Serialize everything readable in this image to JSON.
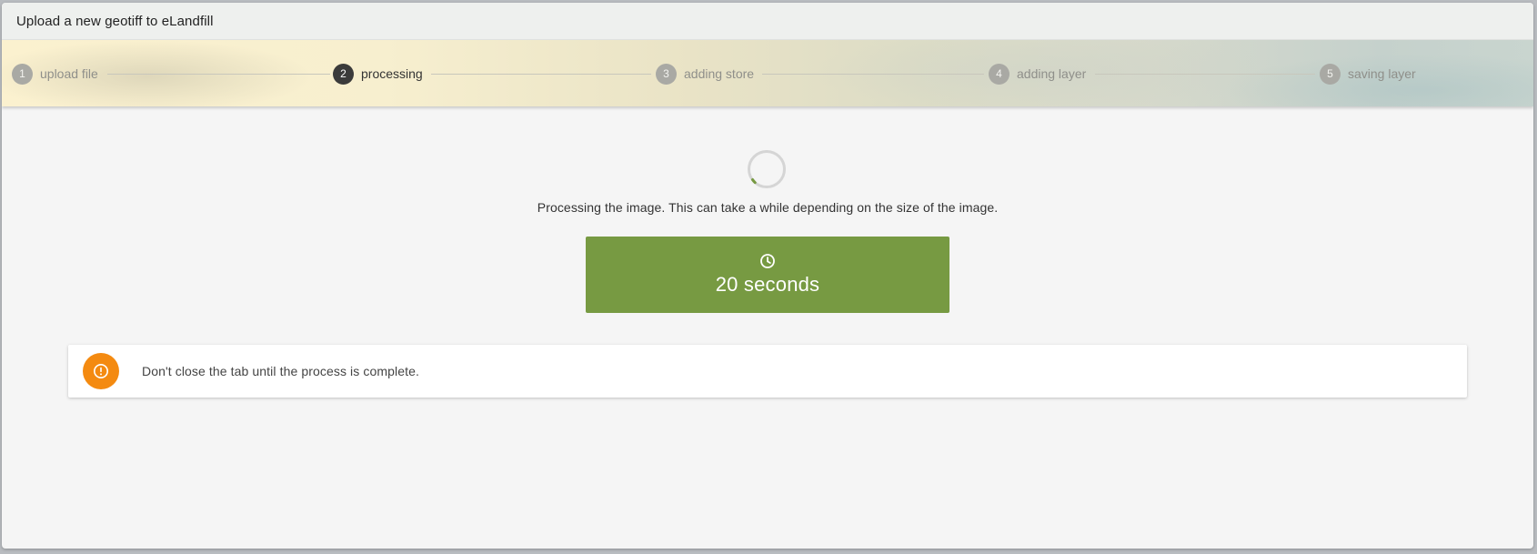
{
  "dialog": {
    "title": "Upload a new geotiff to eLandfill"
  },
  "stepper": {
    "steps": [
      {
        "number": "1",
        "label": "upload file",
        "state": "completed"
      },
      {
        "number": "2",
        "label": "processing",
        "state": "active"
      },
      {
        "number": "3",
        "label": "adding store",
        "state": "pending"
      },
      {
        "number": "4",
        "label": "adding layer",
        "state": "pending"
      },
      {
        "number": "5",
        "label": "saving layer",
        "state": "pending"
      }
    ]
  },
  "processing": {
    "message": "Processing the image. This can take a while depending on the size of the image.",
    "spinner_icon": "loading-spinner",
    "timer_icon": "clock-icon",
    "timer_text": "20 seconds"
  },
  "warning": {
    "icon": "alert-icon",
    "text": "Don't close the tab until the process is complete."
  },
  "colors": {
    "timer_background": "#779a42",
    "warning_icon": "#f48a10",
    "active_step": "#3b3b3b",
    "inactive_step": "#a9a9a4",
    "spinner_accent": "#779a42"
  }
}
